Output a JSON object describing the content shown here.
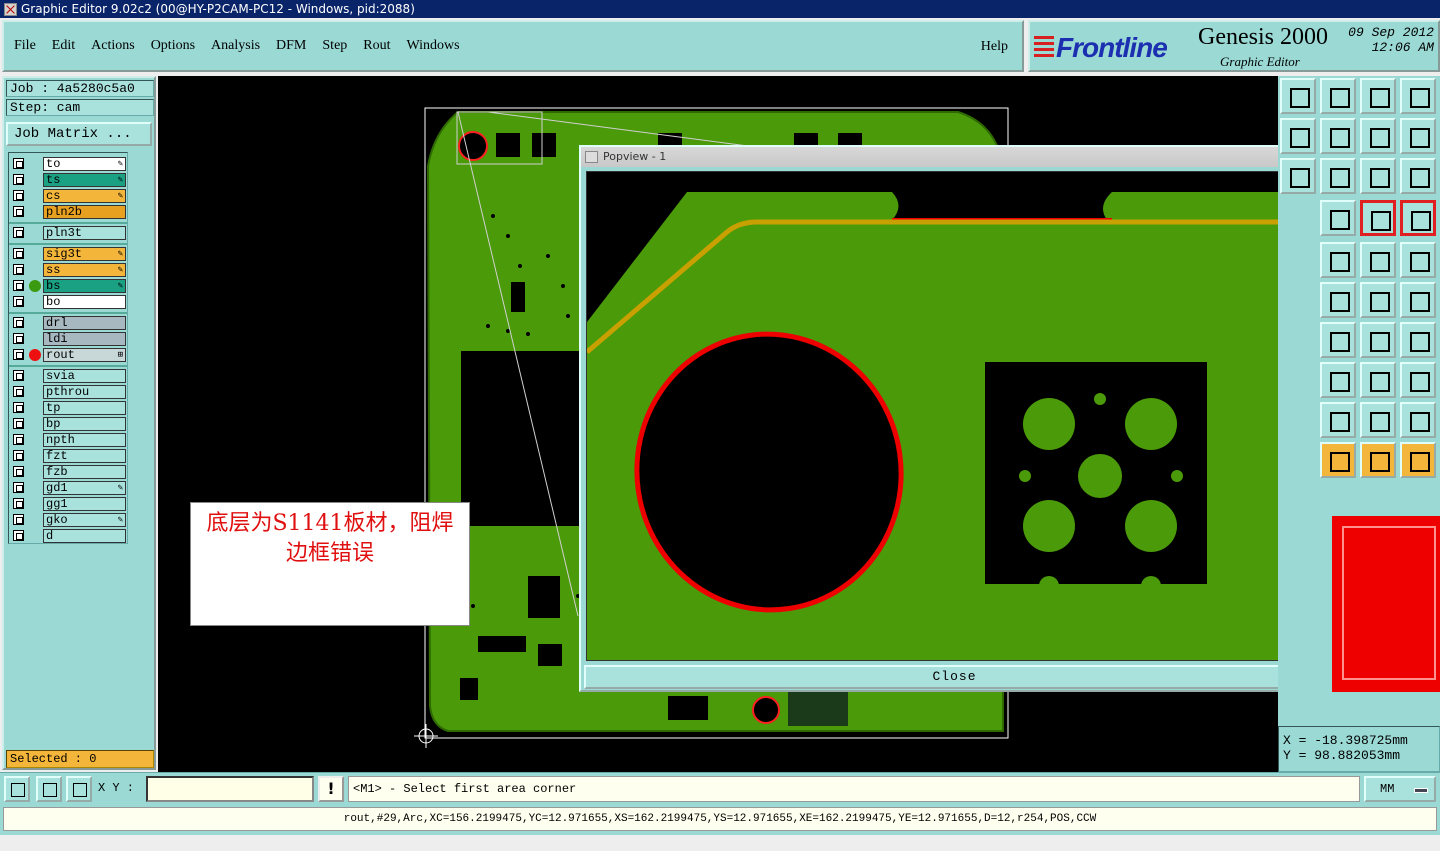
{
  "window": {
    "title": "Graphic Editor 9.02c2 (00@HY-P2CAM-PC12 - Windows, pid:2088)"
  },
  "menu": {
    "items": [
      "File",
      "Edit",
      "Actions",
      "Options",
      "Analysis",
      "DFM",
      "Step",
      "Rout",
      "Windows"
    ],
    "help": "Help"
  },
  "brand": {
    "logo": "Frontline",
    "product": "Genesis 2000",
    "subtitle": "Graphic Editor",
    "date": "09 Sep 2012",
    "time": "12:06 AM"
  },
  "job": {
    "job_label": "Job : 4a5280c5a0",
    "step_label": "Step: cam",
    "matrix_button": "Job Matrix ..."
  },
  "layers": [
    {
      "name": "to",
      "color": "#ffffff",
      "flag": "✎"
    },
    {
      "name": "ts",
      "color": "#1aa083",
      "flag": "✎"
    },
    {
      "name": "cs",
      "color": "#f4b63a",
      "flag": "✎"
    },
    {
      "name": "pln2b",
      "color": "#e8a020",
      "flag": ""
    },
    {
      "name": "pln3t",
      "color": "#a9e1dc",
      "flag": ""
    },
    {
      "name": "sig3t",
      "color": "#f4b63a",
      "flag": "✎"
    },
    {
      "name": "ss",
      "color": "#f4b63a",
      "flag": "✎"
    },
    {
      "name": "bs",
      "color": "#1aa083",
      "flag": "✎"
    },
    {
      "name": "bo",
      "color": "#ffffff",
      "flag": ""
    },
    {
      "name": "drl",
      "color": "#a8b8c0",
      "flag": ""
    },
    {
      "name": "ldi",
      "color": "#a8b8c0",
      "flag": ""
    },
    {
      "name": "rout",
      "color": "#c8d8d8",
      "flag": "⊞"
    },
    {
      "name": "svia",
      "color": "#a9e1dc",
      "flag": ""
    },
    {
      "name": "pthrou",
      "color": "#a9e1dc",
      "flag": ""
    },
    {
      "name": "tp",
      "color": "#a9e1dc",
      "flag": ""
    },
    {
      "name": "bp",
      "color": "#a9e1dc",
      "flag": ""
    },
    {
      "name": "npth",
      "color": "#a9e1dc",
      "flag": ""
    },
    {
      "name": "fzt",
      "color": "#a9e1dc",
      "flag": ""
    },
    {
      "name": "fzb",
      "color": "#a9e1dc",
      "flag": ""
    },
    {
      "name": "gd1",
      "color": "#a9e1dc",
      "flag": "✎"
    },
    {
      "name": "gg1",
      "color": "#a9e1dc",
      "flag": ""
    },
    {
      "name": "gko",
      "color": "#a9e1dc",
      "flag": "✎"
    },
    {
      "name": "d",
      "color": "#a9e1dc",
      "flag": ""
    }
  ],
  "selected": "Selected : 0",
  "annotation": {
    "line1": "底层为S1141板材，阻焊",
    "line2": "边框错误"
  },
  "popview": {
    "title": "Popview - 1",
    "close_label": "Close"
  },
  "coords": {
    "x": "X  = -18.398725mm",
    "y": "Y  = 98.882053mm"
  },
  "status": {
    "xy_label": "X Y :",
    "xy_value": "",
    "warn": "!",
    "prompt": "<M1> - Select first area corner",
    "units": "MM"
  },
  "info_line": "rout,#29,Arc,XC=156.2199475,YC=12.971655,XS=162.2199475,YS=12.971655,XE=162.2199475,YE=12.971655,D=12,r254,POS,CCW",
  "colors": {
    "panel": "#9ad9d4",
    "board_green": "#4a9a0a",
    "highlight_red": "#ee0000",
    "trace_gold": "#c8a000"
  }
}
